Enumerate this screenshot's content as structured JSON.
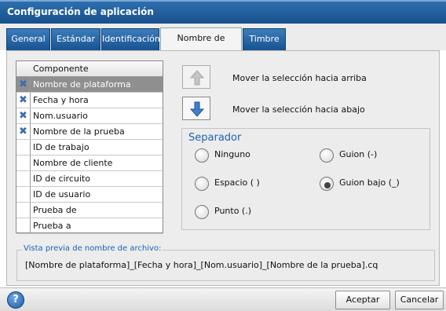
{
  "window": {
    "title": "Configuración de aplicación"
  },
  "tabs": [
    {
      "label": "General"
    },
    {
      "label": "Estándar"
    },
    {
      "label": "Identificación"
    },
    {
      "label": "Nombre de archivo"
    },
    {
      "label": "Timbre"
    }
  ],
  "active_tab_index": 3,
  "component_list": {
    "header": "Componente",
    "items": [
      {
        "label": "Nombre de plataforma",
        "checked": true,
        "selected": true
      },
      {
        "label": "Fecha y hora",
        "checked": true,
        "selected": false
      },
      {
        "label": "Nom.usuario",
        "checked": true,
        "selected": false
      },
      {
        "label": "Nombre de la prueba",
        "checked": true,
        "selected": false
      },
      {
        "label": "ID de trabajo",
        "checked": false,
        "selected": false
      },
      {
        "label": "Nombre de cliente",
        "checked": false,
        "selected": false
      },
      {
        "label": "ID de circuito",
        "checked": false,
        "selected": false
      },
      {
        "label": "ID de usuario",
        "checked": false,
        "selected": false
      },
      {
        "label": "Prueba de",
        "checked": false,
        "selected": false
      },
      {
        "label": "Prueba a",
        "checked": false,
        "selected": false
      }
    ]
  },
  "move": {
    "up_label": "Mover la selección hacia arriba",
    "down_label": "Mover la selección hacia abajo"
  },
  "separator": {
    "title": "Separador",
    "options": [
      {
        "label": "Ninguno",
        "selected": false
      },
      {
        "label": "Guion (-)",
        "selected": false
      },
      {
        "label": "Espacio ( )",
        "selected": false
      },
      {
        "label": "Guion bajo (_)",
        "selected": true
      },
      {
        "label": "Punto (.)",
        "selected": false
      }
    ]
  },
  "preview": {
    "title": "Vista previa de nombre de archivo:",
    "value": "[Nombre de plataforma]_[Fecha y hora]_[Nom.usuario]_[Nombre de la prueba].cq"
  },
  "footer": {
    "help_symbol": "?",
    "accept_label": "Aceptar",
    "cancel_label": "Cancelar"
  },
  "colors": {
    "title_bar": "#1d5a9c",
    "tab_blue": "#2a6aab",
    "section_title": "#1c63b5",
    "check_mark": "#3c6fa8"
  },
  "icons": {
    "move_up": "up-arrow-icon",
    "move_down": "down-arrow-icon",
    "help": "help-icon",
    "check": "x-check-icon"
  }
}
